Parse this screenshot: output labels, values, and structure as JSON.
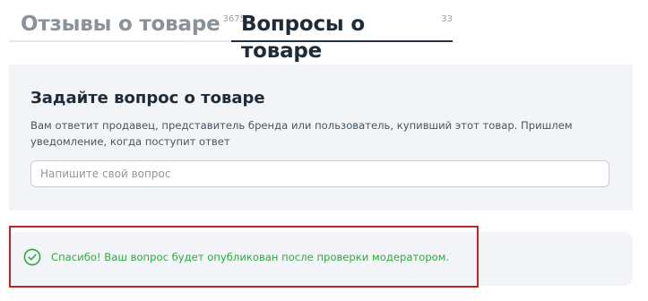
{
  "tabs": [
    {
      "label": "Отзывы о товаре",
      "count": "3675",
      "active": false
    },
    {
      "label": "Вопросы о товаре",
      "count": "33",
      "active": true
    }
  ],
  "ask": {
    "title": "Задайте вопрос о товаре",
    "description": "Вам ответит продавец, представитель бренда или пользователь, купивший этот товар. Пришлем уведомление, когда поступит ответ",
    "placeholder": "Напишите свой вопрос",
    "value": ""
  },
  "notice": {
    "icon": "check-circle-icon",
    "text": "Спасибо! Ваш вопрос будет опубликован после проверки модератором.",
    "color": "#2eaa43"
  },
  "colors": {
    "panel_bg": "#f2f4f7",
    "active_tab_text": "#1f2b36",
    "inactive_tab_text": "#8a9199",
    "highlight_border": "#c0232a"
  }
}
